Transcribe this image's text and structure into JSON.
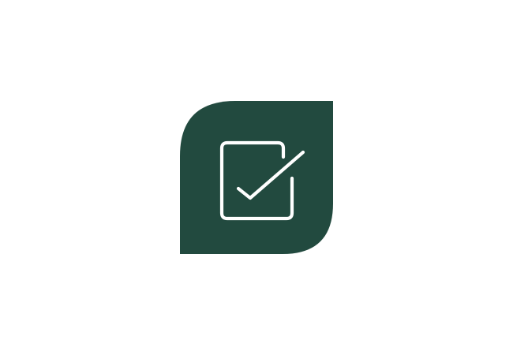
{
  "icon": {
    "name": "checkbox-checked-icon",
    "shape": "leaf",
    "background_color": "#224a3f",
    "stroke_color": "#ffffff"
  },
  "page": {
    "background_color": "#ffffff"
  }
}
